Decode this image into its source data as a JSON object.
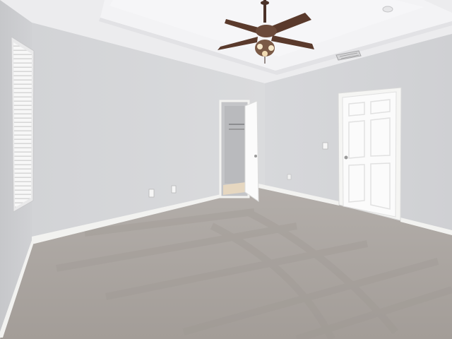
{
  "scene": {
    "palette": {
      "ceiling": "#eeeef0",
      "ceiling_tray": "#f4f4f6",
      "wall_left": "#cfd0d3",
      "wall_back": "#d6d7da",
      "wall_right": "#d3d4d7",
      "carpet": "#a9a39f",
      "carpet_dark": "#9a948f",
      "trim": "#f4f4f2",
      "door": "#fafafa",
      "fan_blade": "#5a3a2c",
      "fan_metal": "#6b4a3a"
    },
    "icons": [
      "ceiling-fan-icon",
      "window-blinds-icon",
      "door-icon",
      "outlet-icon",
      "light-switch-icon",
      "vent-icon"
    ]
  }
}
